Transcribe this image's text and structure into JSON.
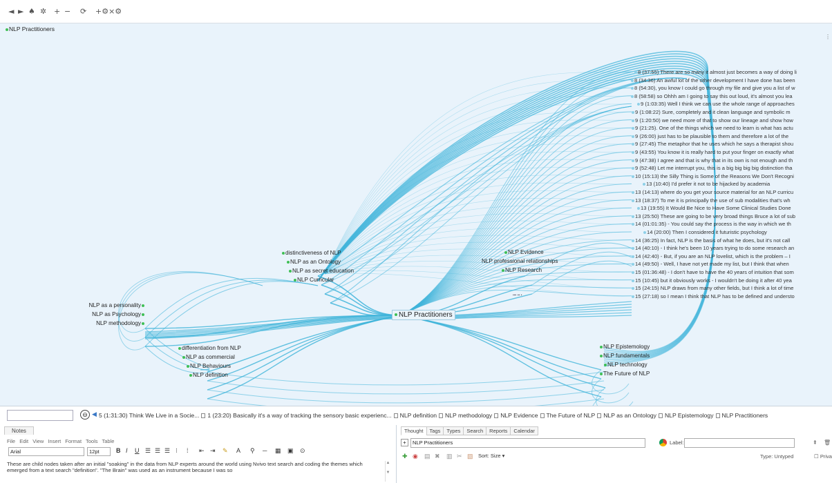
{
  "toolbar": {
    "back": "◄",
    "forward": "►",
    "home": "♠",
    "pin": "✲",
    "plus": "+",
    "minus": "−",
    "refresh": "⟳",
    "settings": "+⚙×⚙"
  },
  "graph": {
    "root_label": "NLP Practitioners",
    "central": "NLP Practitioners",
    "side_marker": "⋮",
    "left_far": [
      "NLP as a personality",
      "NLP as Psychology",
      "NLP methodology"
    ],
    "upper_left": [
      "distinctiveness of NLP",
      "NLP as an Ontology",
      "NLP as secret education",
      "NLP Curricular"
    ],
    "upper_mid": [
      "NLP Evidence",
      "NLP professional relationships",
      "NLP Research"
    ],
    "lower_left": [
      "differentiation from NLP",
      "NLP as commercial",
      "NLP Behaviours",
      "NLP definition"
    ],
    "lower_right": [
      "NLP Epistemology",
      "NLP fundamentals",
      "NLP technology",
      "The Future of NLP"
    ],
    "small_mid": "▪▪▪ ▪▪ ▪",
    "thoughts": [
      "8 (37:55) There are so many it almost just becomes a way of doing li",
      "8 (34:36) An awful lot of the other development I have done has been",
      "8 (54:30), you know I could go through my file and give you a list of w",
      "8 (58:58) so Ohhh am I going to say this out loud, it's almost you lea",
      "9 (1:03:35) Well I think we can use the whole range of approaches",
      "9 (1:08:22) Sure, completely and it clean language and symbolic m",
      "9 (1:20:50) we need more of that to show our lineage and show how",
      "9 (21:25). One of the things which we need to learn is what has actu",
      "9 (26:00) just has to be plausible to them and therefore a lot of the",
      "9 (27:45) The metaphor that he uses which he says a therapist shou",
      "9 (43:55) You know it is really hard to put your finger on exactly what",
      "9 (47:38) I agree and that is why that in its own is not enough and th",
      "9 (52:48) Let me interrupt you, this is a big big big big distinction tha",
      "10 (15:13) the Silly Thing is Some of the Reasons We Don't Recogni",
      "13 (10:40) I'd prefer it not to be hijacked by academia",
      "13 (14:13) where do you get your source material for an NLP curricu",
      "13 (18:37) To me it is principally the use of sub modalities that's wh",
      "13 (19:55) It Would Be Nice to Have Some Clinical Studies Done",
      "13 (25:50) These are going to be very broad things Bruce a lot of sub",
      "14 (01:01:35) - You could say the process is the way in which we th",
      "14 (20:00) Then I considered it futuristic psychology",
      "14 (36:25) In fact, NLP is the basis of what he does, but it's not call",
      "14 (40:10) - I think he's been 10 years trying to do some research an",
      "14 (42:40) - But, if you are an NLP lovelist, which is the problem – I",
      "14 (49:50) - Well, I have not yet made my list, but I think that when",
      "15 (01:36:48) - I don't have to have the 40 years of intuition that som",
      "15 (10:45) but it obviously works - I wouldn't be doing it after 40 yea",
      "15 (24:15) NLP draws from many other fields, but I think a lot of time",
      "15 (27:18) so I mean I think that NLP has to be defined and understo"
    ]
  },
  "breadcrumb": {
    "history_icon": "⊖",
    "back_icon": "◀",
    "items": [
      "5 (1:31:30) Think We Live in a Socie...",
      "1 (23:20) Basically it's a way of tracking the sensory basic experienc...",
      "NLP definition",
      "NLP methodology",
      "NLP Evidence",
      "The Future of NLP",
      "NLP as an Ontology",
      "NLP Epistemology",
      "NLP Practitioners"
    ]
  },
  "notes": {
    "tab_label": "Notes",
    "menu": [
      "File",
      "Edit",
      "View",
      "Insert",
      "Format",
      "Tools",
      "Table"
    ],
    "font": "Arial",
    "size": "12pt",
    "body": "These are child nodes taken after an initial \"soaking\" in the data from NLP experts around the world using Nvivo text search and coding the themes which emerged from a text search \"definition\". \"The Brain\" was used as an instrument because I was so",
    "scroll_up": "▲",
    "scroll_down": "▼"
  },
  "thought_panel": {
    "tabs": [
      "Thought",
      "Tags",
      "Types",
      "Search",
      "Reports",
      "Calendar"
    ],
    "name_plus": "+",
    "name_value": "NLP Practitioners",
    "label_caption": "Label:",
    "label_value": "",
    "pin": "⇞",
    "trash": "🗑",
    "sort_label": "Sort: Size ▾",
    "type_caption": "Type: Untyped",
    "private_label": "Priva"
  },
  "colors": {
    "canvas": "#e9f3fb",
    "link": "#3fb4da",
    "node_dot": "#3fbf55"
  }
}
